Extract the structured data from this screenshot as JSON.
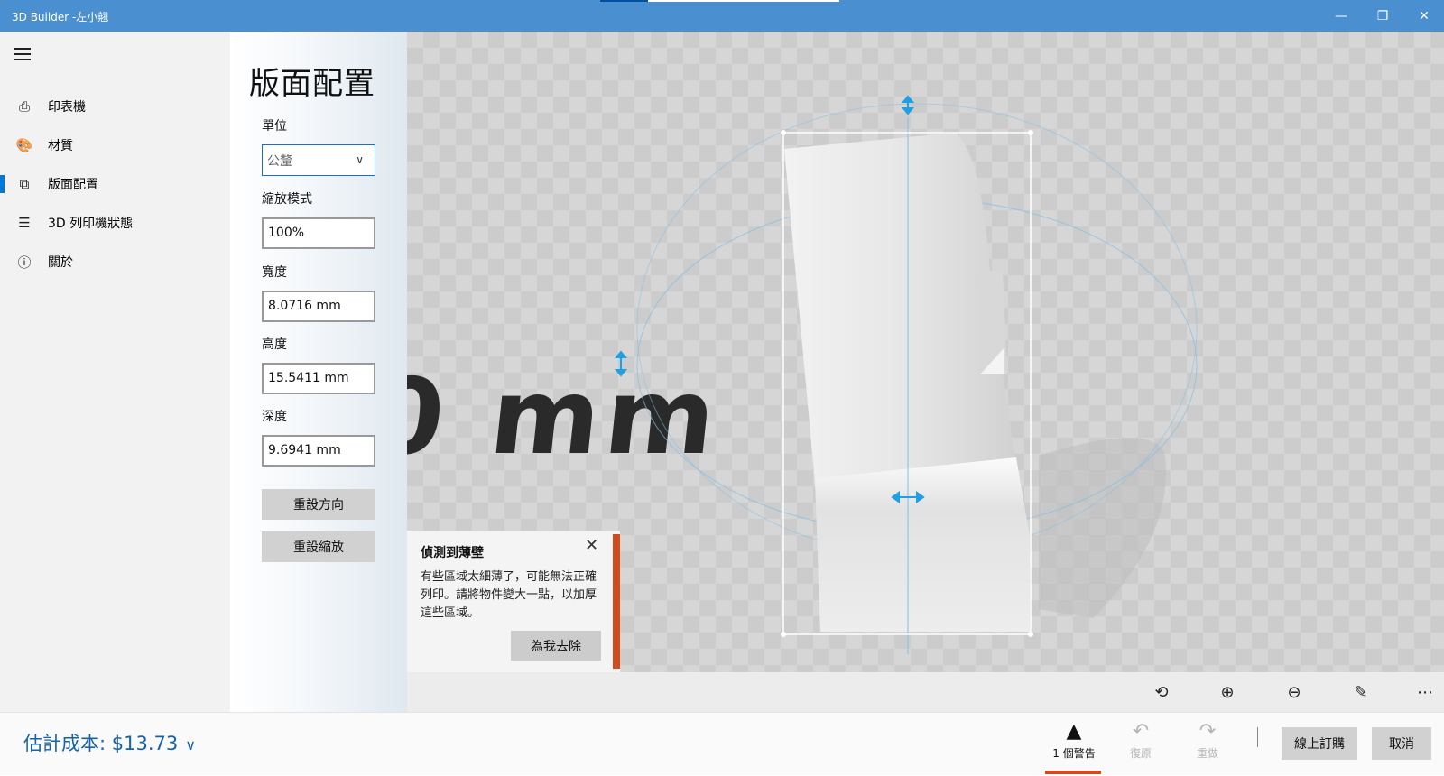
{
  "titlebar": {
    "title": "3D Builder -左小翹",
    "progress_fraction": 0.2,
    "minimize_glyph": "—",
    "maximize_glyph": "❐",
    "close_glyph": "✕"
  },
  "nav": {
    "menu_icon": "hamburger-icon",
    "active_index": 2,
    "items": [
      {
        "label": "印表機",
        "icon": "printer-icon",
        "glyph": "⎙"
      },
      {
        "label": "材質",
        "icon": "palette-icon",
        "glyph": "🎨"
      },
      {
        "label": "版面配置",
        "icon": "layout-cubes-icon",
        "glyph": "⧉"
      },
      {
        "label": "3D 列印機狀態",
        "icon": "checklist-icon",
        "glyph": "☰"
      },
      {
        "label": "關於",
        "icon": "info-icon",
        "glyph": "ⓘ"
      }
    ]
  },
  "panel": {
    "title": "版面配置",
    "unit_label": "單位",
    "unit_value": "公釐",
    "scale_mode_label": "縮放模式",
    "scale_value": "100%",
    "width_label": "寬度",
    "width_value": "8.0716 mm",
    "height_label": "高度",
    "height_value": "15.5411 mm",
    "depth_label": "深度",
    "depth_value": "9.6941 mm",
    "reset_orientation": "重設方向",
    "reset_scale": "重設縮放"
  },
  "scene": {
    "bed_text": "0 mm"
  },
  "warning": {
    "title": "偵測到薄壁",
    "body": "有些區域太細薄了，可能無法正確列印。請將物件變大一點，以加厚這些區域。",
    "fix_button": "為我去除",
    "accent_color": "#d24a1d"
  },
  "toolbar": {
    "items": [
      {
        "icon": "view-camera-icon",
        "glyph": "⟲"
      },
      {
        "icon": "zoom-in-icon",
        "glyph": "⊕"
      },
      {
        "icon": "zoom-out-icon",
        "glyph": "⊖"
      },
      {
        "icon": "pencil-icon",
        "glyph": "✎"
      },
      {
        "icon": "more-icon",
        "glyph": "⋯"
      }
    ]
  },
  "bottom": {
    "cost": "估計成本: $13.73",
    "cost_chevron": "∨",
    "warnings_label": "1 個警告",
    "warning_glyph": "▲",
    "undo_label": "復原",
    "undo_glyph": "↶",
    "redo_label": "重做",
    "redo_glyph": "↷",
    "order_online": "線上訂購",
    "cancel": "取消",
    "accent_color": "#1762a8"
  }
}
